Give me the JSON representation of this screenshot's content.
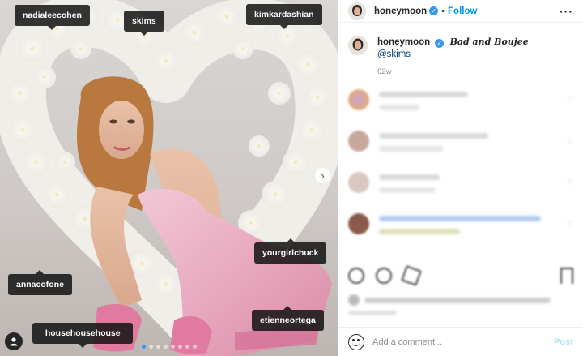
{
  "media": {
    "tags": [
      {
        "name": "nadialeecohen"
      },
      {
        "name": "skims"
      },
      {
        "name": "kimkardashian"
      },
      {
        "name": "yourgirlchuck"
      },
      {
        "name": "annacofone"
      },
      {
        "name": "etienneortega"
      },
      {
        "name": "_househousehouse_"
      }
    ],
    "next_icon": "chevron-right-icon",
    "user_icon": "user-tag-icon",
    "carousel_count": 8,
    "carousel_active": 0
  },
  "post": {
    "username": "honeymoon",
    "follow_label": "Follow",
    "more_label": "···",
    "caption_title": "Bad and Boujee",
    "caption_mention": "@skims",
    "age": "62w"
  },
  "comment_box": {
    "placeholder": "Add a comment...",
    "post_label": "Post"
  },
  "colors": {
    "accent": "#0095f6",
    "verified": "#3897f0",
    "tag_bg": "#141414"
  }
}
